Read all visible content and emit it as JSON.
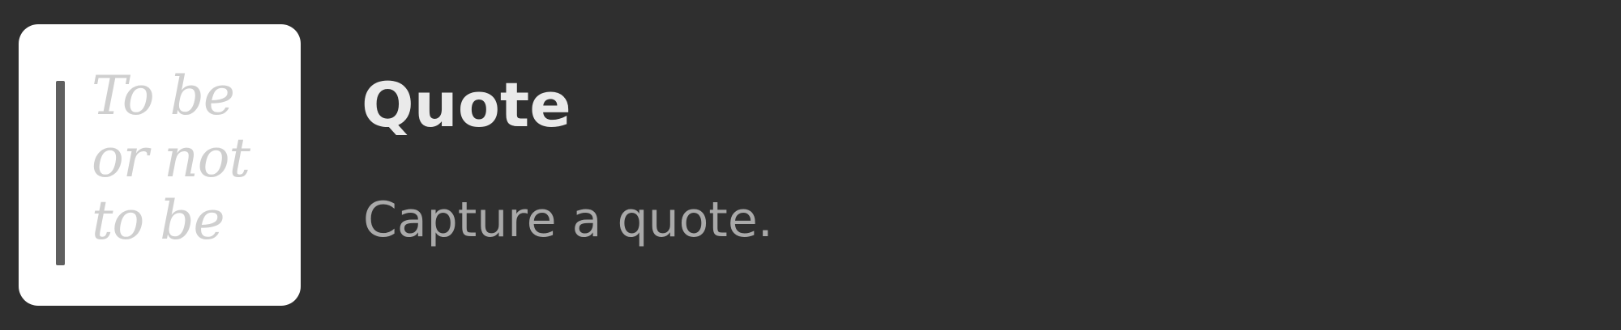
{
  "item": {
    "thumbnail_text": "To be\nor not\nto be",
    "title": "Quote",
    "description": "Capture a quote."
  }
}
